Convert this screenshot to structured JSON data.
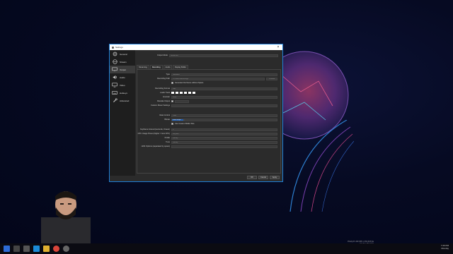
{
  "window": {
    "title": "Settings",
    "close": "×"
  },
  "sidebar": {
    "items": [
      {
        "label": "General",
        "icon": "gear-icon"
      },
      {
        "label": "Stream",
        "icon": "globe-icon"
      },
      {
        "label": "Output",
        "icon": "monitor-icon",
        "active": true
      },
      {
        "label": "Audio",
        "icon": "speaker-icon"
      },
      {
        "label": "Video",
        "icon": "monitor-icon"
      },
      {
        "label": "Hotkeys",
        "icon": "keyboard-icon"
      },
      {
        "label": "Advanced",
        "icon": "wrench-icon"
      }
    ]
  },
  "output": {
    "mode_label": "Output Mode",
    "mode_value": "Advanced",
    "tabs": [
      "Streaming",
      "Recording",
      "Audio",
      "Replay Buffer"
    ],
    "type_label": "Type",
    "type_value": "Standard",
    "path_label": "Recording Path",
    "path_value": "C:/Users/Recordings",
    "browse_label": "Browse",
    "space_label": "Generate File Name without Space",
    "format_label": "Recording Format",
    "format_value": "mkv",
    "audio_track_label": "Audio Track",
    "encoder_label": "Encoder",
    "encoder_value": "x264",
    "rescale_label": "Rescale Output",
    "muxer_label": "Custom Muxer Settings",
    "rate_control_label": "Rate Control",
    "rate_control_value": "CBR",
    "bitrate_label": "Bitrate",
    "bitrate_value": "2500 Kbps",
    "buffer_label": "Use Custom Buffer Size",
    "keyframe_label": "Keyframe Interval (seconds, 0=auto)",
    "keyframe_value": "0",
    "preset_label": "CPU Usage Preset (higher = less CPU)",
    "preset_value": "veryfast",
    "profile_label": "Profile",
    "profile_value": "(None)",
    "tune_label": "Tune",
    "tune_value": "(None)",
    "x264_label": "x264 Options (separated by space)",
    "x264_value": ""
  },
  "footer": {
    "ok": "OK",
    "cancel": "Cancel",
    "apply": "Apply"
  },
  "tray": {
    "time": "7:26 PM",
    "day": "Monday",
    "date": "12/9/2019"
  },
  "tray_status": {
    "line1": "Priority R: 220 CPU: 2.3%  32.5 fps",
    "line2": "Link Dev: Bap 6 ha",
    "line3": "Low: 0.000.0%"
  },
  "colors": {
    "accent": "#1f7fd6",
    "window_bg": "#2b2b2b",
    "sidebar_bg": "#1e1e1e"
  }
}
